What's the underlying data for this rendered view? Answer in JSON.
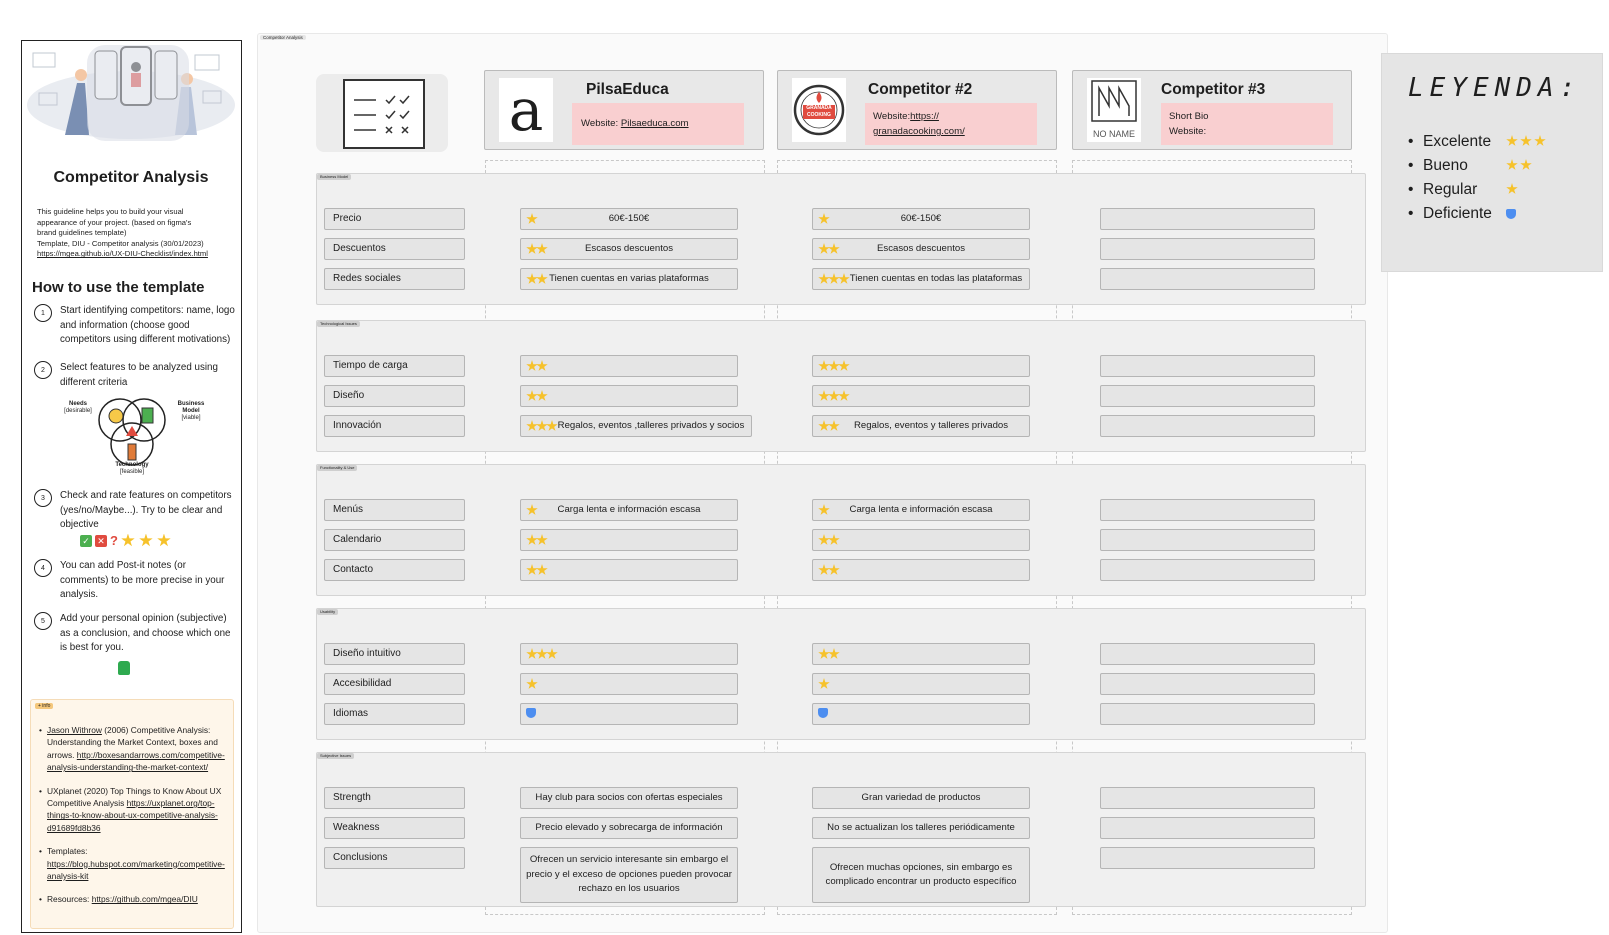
{
  "left_panel": {
    "title": "Competitor Analysis",
    "intro_lines": [
      "This  guideline helps you to build your visual",
      "appearance of your project.  (based  on figma's",
      "brand guidelines template)",
      "Template, DIU -  Competitor analysis  (30/01/2023)"
    ],
    "intro_link": "https://mgea.github.io/UX-DIU-Checklist/index.html",
    "how_to_title": "How to use the template",
    "steps": [
      {
        "num": "1",
        "text": "Start  identifying competitors: name, logo and information  (choose good competitors using different motivations)"
      },
      {
        "num": "2",
        "text": "Select features to be analyzed using different criteria"
      },
      {
        "num": "3",
        "text": "Check and rate features on competitors (yes/no/Maybe...). Try to be clear and objective"
      },
      {
        "num": "4",
        "text": "You can add Post-it notes (or comments) to be more precise in your analysis."
      },
      {
        "num": "5",
        "text": "Add your personal opinion (subjective) as a conclusion, and choose which one is best for you."
      }
    ],
    "venn": {
      "needs": "Needs",
      "needs_sub": "[desirable]",
      "business": "Business",
      "business2": "Model",
      "business_sub": "[viable]",
      "technology": "Technology",
      "technology_sub": "[feasible]"
    },
    "info_tag": "+ info",
    "info_items": [
      {
        "a": "Jason Withrow",
        "b": " (2006) Competitive Analysis: Understanding the Market Context, boxes and arrows. ",
        "c": "http://boxesandarrows.com/competitive-analysis-understanding-the-market-context/"
      },
      {
        "a": "",
        "b": "UXplanet (2020) Top Things to Know About UX Competitive Analysis ",
        "c": "https://uxplanet.org/top-things-to-know-about-ux-competitive-analysis-d91689fd8b36"
      },
      {
        "a": "",
        "b": "Templates: ",
        "c": "https://blog.hubspot.com/marketing/competitive-analysis-kit"
      },
      {
        "a": "",
        "b": "Resources: ",
        "c": "https://github.com/mgea/DIU"
      }
    ]
  },
  "board": {
    "tag": "Competitor Analysis",
    "competitors": [
      {
        "name": "PilsaEduca",
        "label": "Website: ",
        "link": "Pilsaeduca.com",
        "logo_text": "a"
      },
      {
        "name": "Competitor #2",
        "label": "Website:",
        "link": "https://granadacooking.com/",
        "link1": "https://",
        "link2": "granadacooking.com/",
        "logo_text": "GRANADA COOKING EXPERIENCE"
      },
      {
        "name": "Competitor #3",
        "label": "Short Bio",
        "label2": "Website:",
        "logo_text": "NO NAME"
      }
    ],
    "sections": [
      {
        "tag": "Business Model",
        "rows": [
          {
            "label": "Precio",
            "c1": {
              "stars": 1,
              "text": "60€-150€"
            },
            "c2": {
              "stars": 1,
              "text": "60€-150€"
            }
          },
          {
            "label": "Descuentos",
            "c1": {
              "stars": 2,
              "text": "Escasos descuentos"
            },
            "c2": {
              "stars": 2,
              "text": "Escasos descuentos"
            }
          },
          {
            "label": "Redes sociales",
            "c1": {
              "stars": 2,
              "text": "Tienen cuentas en varias plataformas"
            },
            "c2": {
              "stars": 3,
              "text": "Tienen cuentas en todas las plataformas"
            }
          }
        ]
      },
      {
        "tag": "Technological Issues",
        "rows": [
          {
            "label": "Tiempo de carga",
            "c1": {
              "stars": 2,
              "text": ""
            },
            "c2": {
              "stars": 3,
              "text": ""
            }
          },
          {
            "label": "Diseño",
            "c1": {
              "stars": 2,
              "text": ""
            },
            "c2": {
              "stars": 3,
              "text": ""
            }
          },
          {
            "label": "Innovación",
            "c1": {
              "stars": 3,
              "text": "Regalos, eventos ,talleres privados y socios"
            },
            "c2": {
              "stars": 2,
              "text": "Regalos, eventos y talleres privados"
            }
          }
        ]
      },
      {
        "tag": "Functionality & Use",
        "rows": [
          {
            "label": "Menús",
            "c1": {
              "stars": 1,
              "text": "Carga lenta e información escasa"
            },
            "c2": {
              "stars": 1,
              "text": "Carga lenta e información escasa"
            }
          },
          {
            "label": "Calendario",
            "c1": {
              "stars": 2,
              "text": ""
            },
            "c2": {
              "stars": 2,
              "text": ""
            }
          },
          {
            "label": "Contacto",
            "c1": {
              "stars": 2,
              "text": ""
            },
            "c2": {
              "stars": 2,
              "text": ""
            }
          }
        ]
      },
      {
        "tag": "Usability",
        "rows": [
          {
            "label": "Diseño intuitivo",
            "c1": {
              "stars": 3,
              "text": ""
            },
            "c2": {
              "stars": 2,
              "text": ""
            }
          },
          {
            "label": "Accesibilidad",
            "c1": {
              "stars": 1,
              "text": ""
            },
            "c2": {
              "stars": 1,
              "text": ""
            }
          },
          {
            "label": "Idiomas",
            "c1": {
              "stars": 0,
              "thumb": true,
              "text": ""
            },
            "c2": {
              "stars": 0,
              "thumb": true,
              "text": ""
            }
          }
        ]
      },
      {
        "tag": "Subjective Issues",
        "rows": [
          {
            "label": "Strength",
            "c1": {
              "stars": 0,
              "text": "Hay club para socios con ofertas especiales"
            },
            "c2": {
              "stars": 0,
              "text": "Gran variedad de productos"
            }
          },
          {
            "label": "Weakness",
            "c1": {
              "stars": 0,
              "text": "Precio elevado y sobrecarga de información"
            },
            "c2": {
              "stars": 0,
              "text": "No se actualizan los talleres periódicamente"
            }
          },
          {
            "label": "Conclusions",
            "c1": {
              "stars": 0,
              "text": "Ofrecen un servicio interesante sin embargo el precio y el exceso de opciones pueden provocar rechazo  en los usuarios"
            },
            "c2": {
              "stars": 0,
              "text": "Ofrecen muchas opciones, sin embargo es complicado encontrar un producto específico"
            }
          }
        ]
      }
    ]
  },
  "legend": {
    "title": "LEYENDA:",
    "items": [
      {
        "label": "Excelente",
        "stars": 3
      },
      {
        "label": "Bueno",
        "stars": 2
      },
      {
        "label": "Regular",
        "stars": 1
      },
      {
        "label": "Deficiente",
        "stars": 0,
        "thumb": true
      }
    ]
  },
  "colors": {
    "star": "#f6c22b",
    "pink": "#f9cfd0",
    "info_bg": "#fef6ea",
    "thumb": "#4d8ef0"
  }
}
